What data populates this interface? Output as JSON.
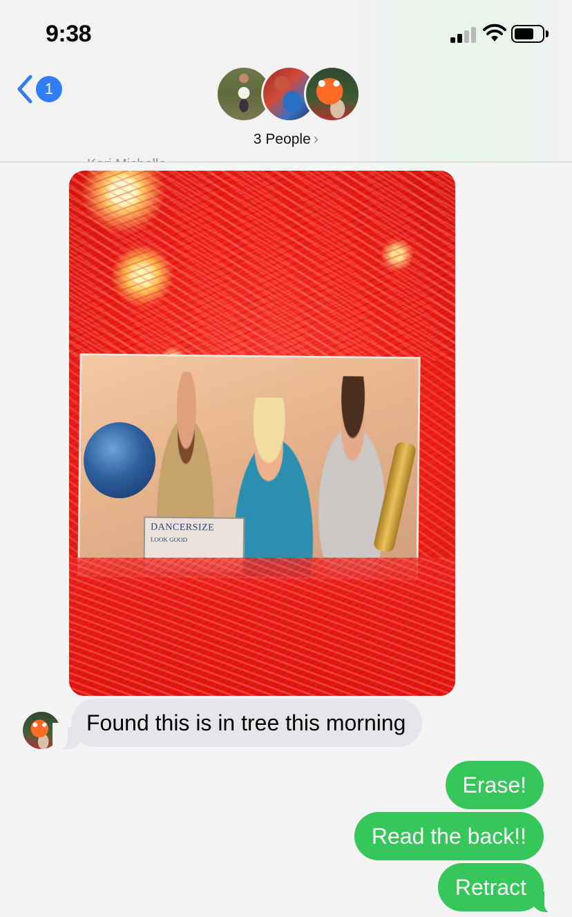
{
  "status_bar": {
    "time": "9:38",
    "signal_icon": "cellular-signal-icon",
    "wifi_icon": "wifi-icon",
    "battery_icon": "battery-icon"
  },
  "header": {
    "back_icon": "chevron-left-icon",
    "unread_count": "1",
    "group_label": "3 People",
    "group_chevron": "›",
    "avatars": [
      "avatar-person",
      "avatar-ride",
      "avatar-squid-costume"
    ],
    "sender_name_partial": "Kari Michelle"
  },
  "messages": {
    "photo": {
      "sign_text": "DANCERSIZE",
      "sign_subtext": "LOOK GOOD"
    },
    "incoming_text": "Found this is in tree this morning",
    "outgoing": [
      "Erase!",
      "Read the back!!",
      "Retract"
    ]
  },
  "colors": {
    "accent_blue": "#2f7cf6",
    "outgoing_green": "#35c759",
    "incoming_gray": "#e5e5ea"
  }
}
